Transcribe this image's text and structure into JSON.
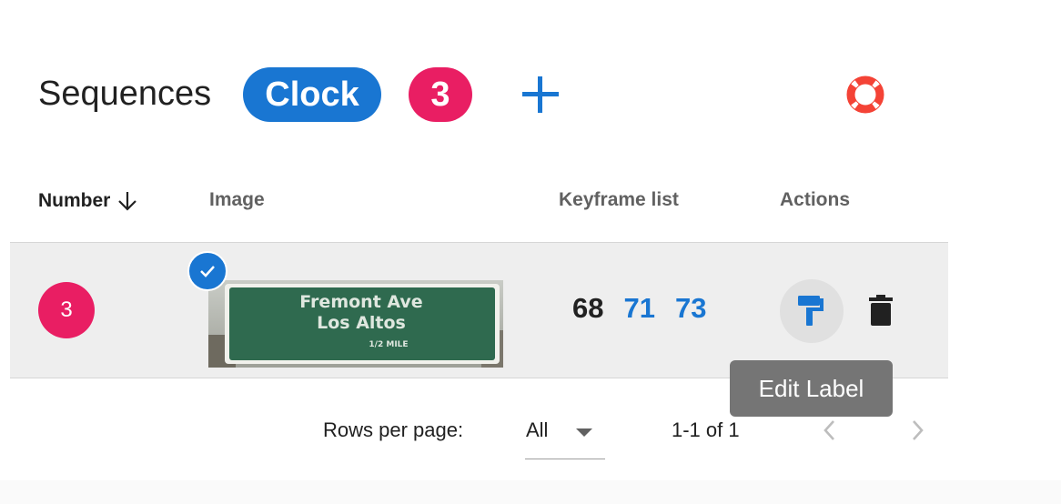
{
  "header": {
    "title": "Sequences",
    "label_chip": "Clock",
    "count_chip": "3",
    "add_icon": "plus-icon",
    "help_icon": "lifebuoy-icon"
  },
  "table": {
    "columns": {
      "number": "Number",
      "image": "Image",
      "keyframes": "Keyframe list",
      "actions": "Actions"
    },
    "sort": {
      "column": "Number",
      "direction": "descending",
      "icon": "arrow-down-icon"
    },
    "rows": [
      {
        "number": "3",
        "selected": true,
        "image_sign_text": [
          "Fremont Ave",
          "Los Altos",
          "1/2 MILE"
        ],
        "keyframes": [
          "68",
          "71",
          "73"
        ],
        "actions": [
          "paint-roller-icon",
          "trash-icon"
        ]
      }
    ]
  },
  "tooltip": {
    "text": "Edit Label"
  },
  "pagination": {
    "rows_per_page_label": "Rows per page:",
    "rows_per_page_value": "All",
    "range_text": "1-1 of 1"
  },
  "colors": {
    "primary": "#1976d2",
    "accent": "#e91e63",
    "help_icon": "#f44336",
    "row_background": "#eeeeee",
    "tooltip_background": "#757575"
  }
}
